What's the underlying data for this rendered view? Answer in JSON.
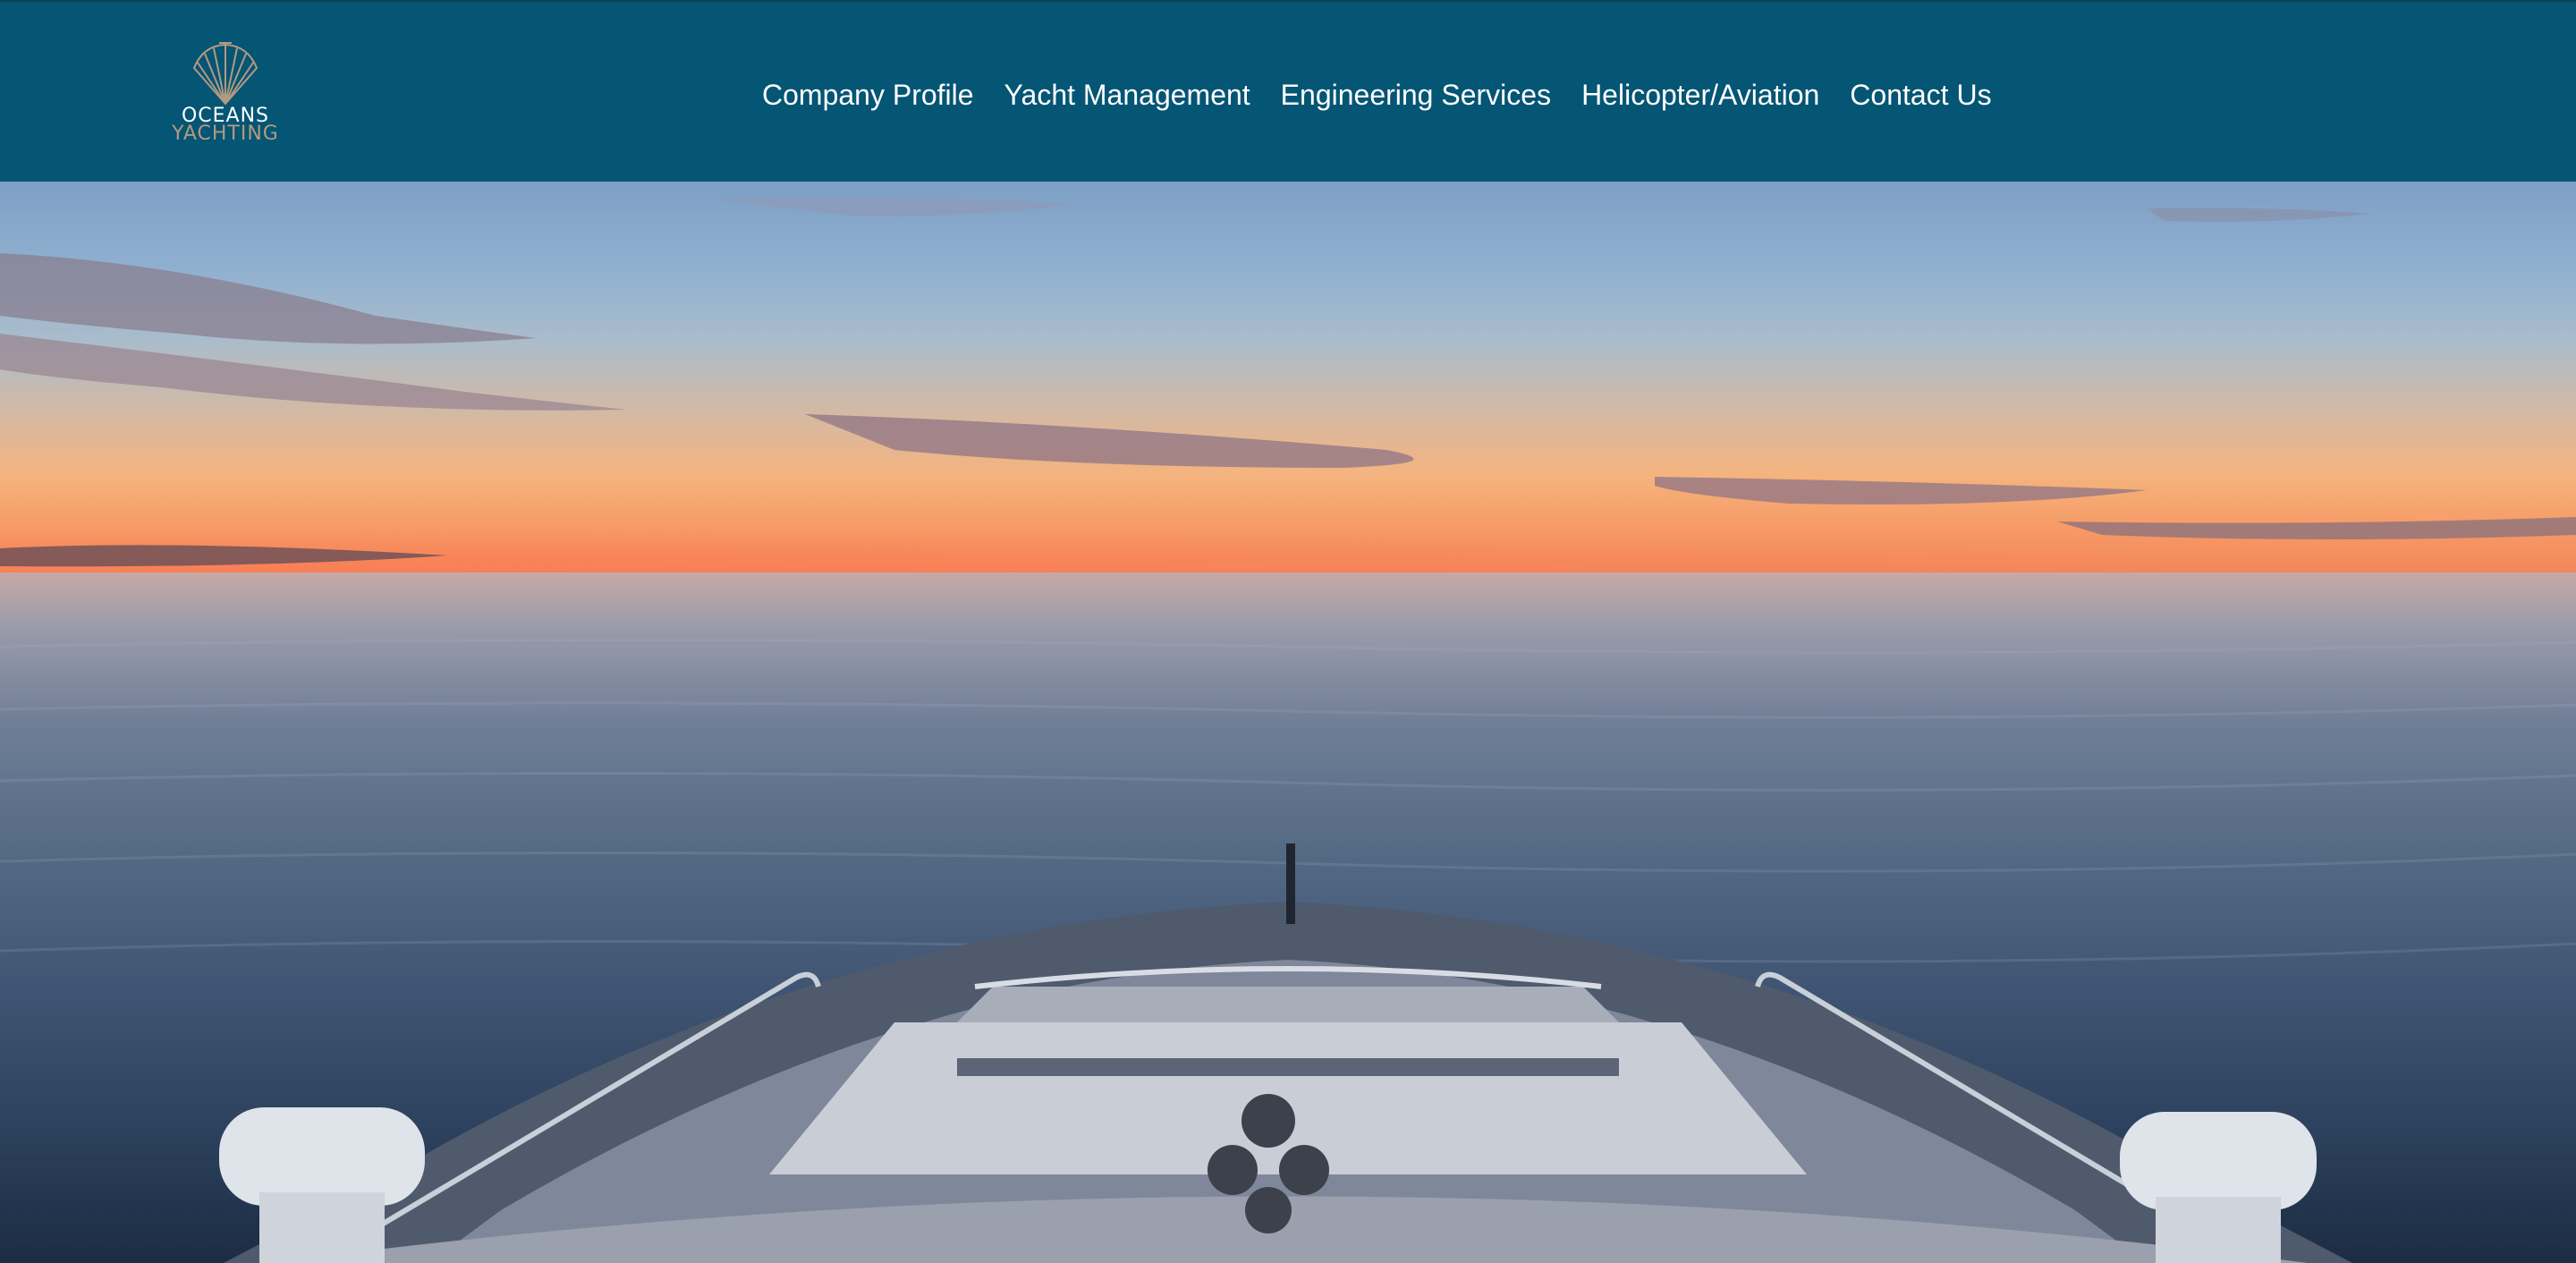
{
  "brand": {
    "name_line1": "OCEANS",
    "name_line2": "YACHTING",
    "logo_icon": "fan-shell-logo-icon"
  },
  "nav": {
    "items": [
      {
        "label": "Company Profile"
      },
      {
        "label": "Yacht Management"
      },
      {
        "label": "Engineering Services"
      },
      {
        "label": "Helicopter/Aviation"
      },
      {
        "label": "Contact Us"
      }
    ]
  },
  "hero": {
    "image": "yacht-bow-at-sunset-image"
  },
  "colors": {
    "header_bg": "#055574",
    "nav_text": "#ffffff",
    "logo_gold": "#b39a80"
  }
}
